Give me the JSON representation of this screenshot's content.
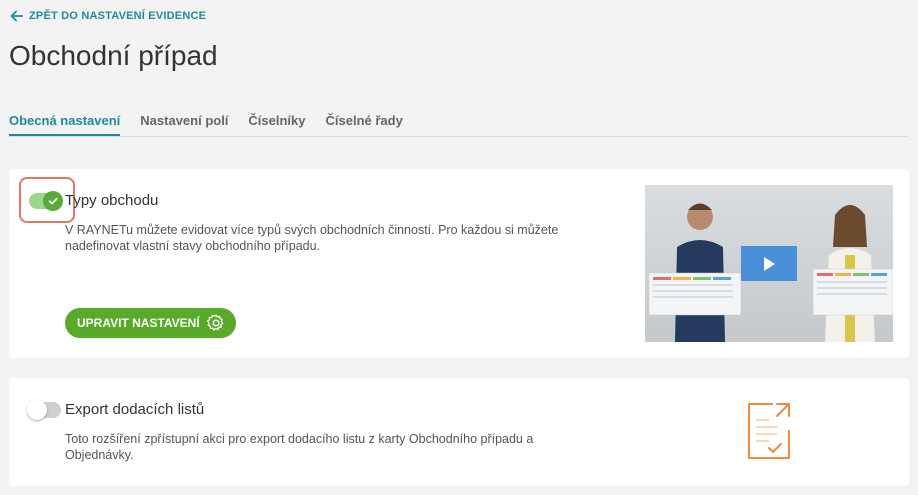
{
  "back_link": {
    "label": "ZPĚT DO NASTAVENÍ EVIDENCE",
    "icon": "arrow-left-icon"
  },
  "page": {
    "title": "Obchodní případ"
  },
  "tabs": [
    {
      "label": "Obecná nastavení",
      "active": true
    },
    {
      "label": "Nastavení polí",
      "active": false
    },
    {
      "label": "Číselníky",
      "active": false
    },
    {
      "label": "Číselné řady",
      "active": false
    }
  ],
  "cards": [
    {
      "title": "Typy obchodu",
      "enabled": true,
      "description": "V RAYNETu můžete evidovat více typů svých obchodních činností. Pro každou si můžete nadefinovat vlastní stavy obchodního případu.",
      "button_label": "UPRAVIT NASTAVENÍ",
      "button_icon": "gear-icon",
      "media": "video-thumbnail"
    },
    {
      "title": "Export dodacích listů",
      "enabled": false,
      "description": "Toto rozšíření zpřístupní akci pro export dodacího listu z karty Obchodního případu a Objednávky.",
      "icon": "document-export-icon"
    }
  ],
  "colors": {
    "accent": "#1f8a9a",
    "toggle_on": "#5aaa3a",
    "button": "#5aaa2a",
    "highlight": "#e07a5f",
    "doc_icon": "#f08a3c",
    "play_button": "#4a90d9"
  }
}
